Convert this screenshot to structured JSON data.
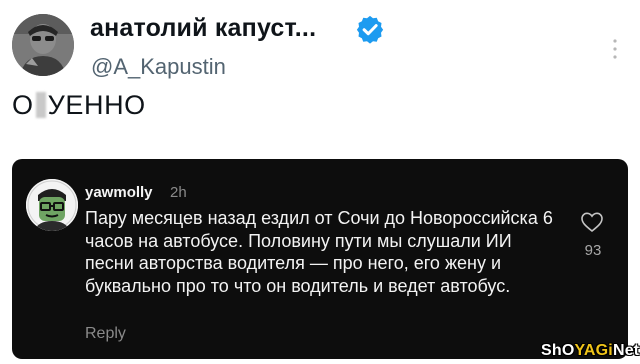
{
  "author": {
    "display_name": "анатолий капуст...",
    "handle": "@A_Kapustin",
    "verified": true,
    "avatar_icon": "profile-photo"
  },
  "tweet": {
    "text_before": "О",
    "text_after": "УЕННО"
  },
  "reply": {
    "username": "yawmolly",
    "time": "2h",
    "body": "Пару месяцев назад ездил от Сочи до Новороссийска 6 часов на автобусе. Половину пути мы слушали ИИ песни авторства водителя — про него, его жену и буквально про то что он водитель и ведет автобус.",
    "reply_label": "Reply",
    "like_count": "93",
    "avatar_icon": "cartoon-face-avatar"
  },
  "watermark": {
    "part1": "ShO",
    "part2": "YAGi",
    "part3": "Net"
  },
  "colors": {
    "verified_blue": "#1d9bf0",
    "card_bg": "#0d0d0d",
    "watermark_accent": "#f0c419"
  }
}
